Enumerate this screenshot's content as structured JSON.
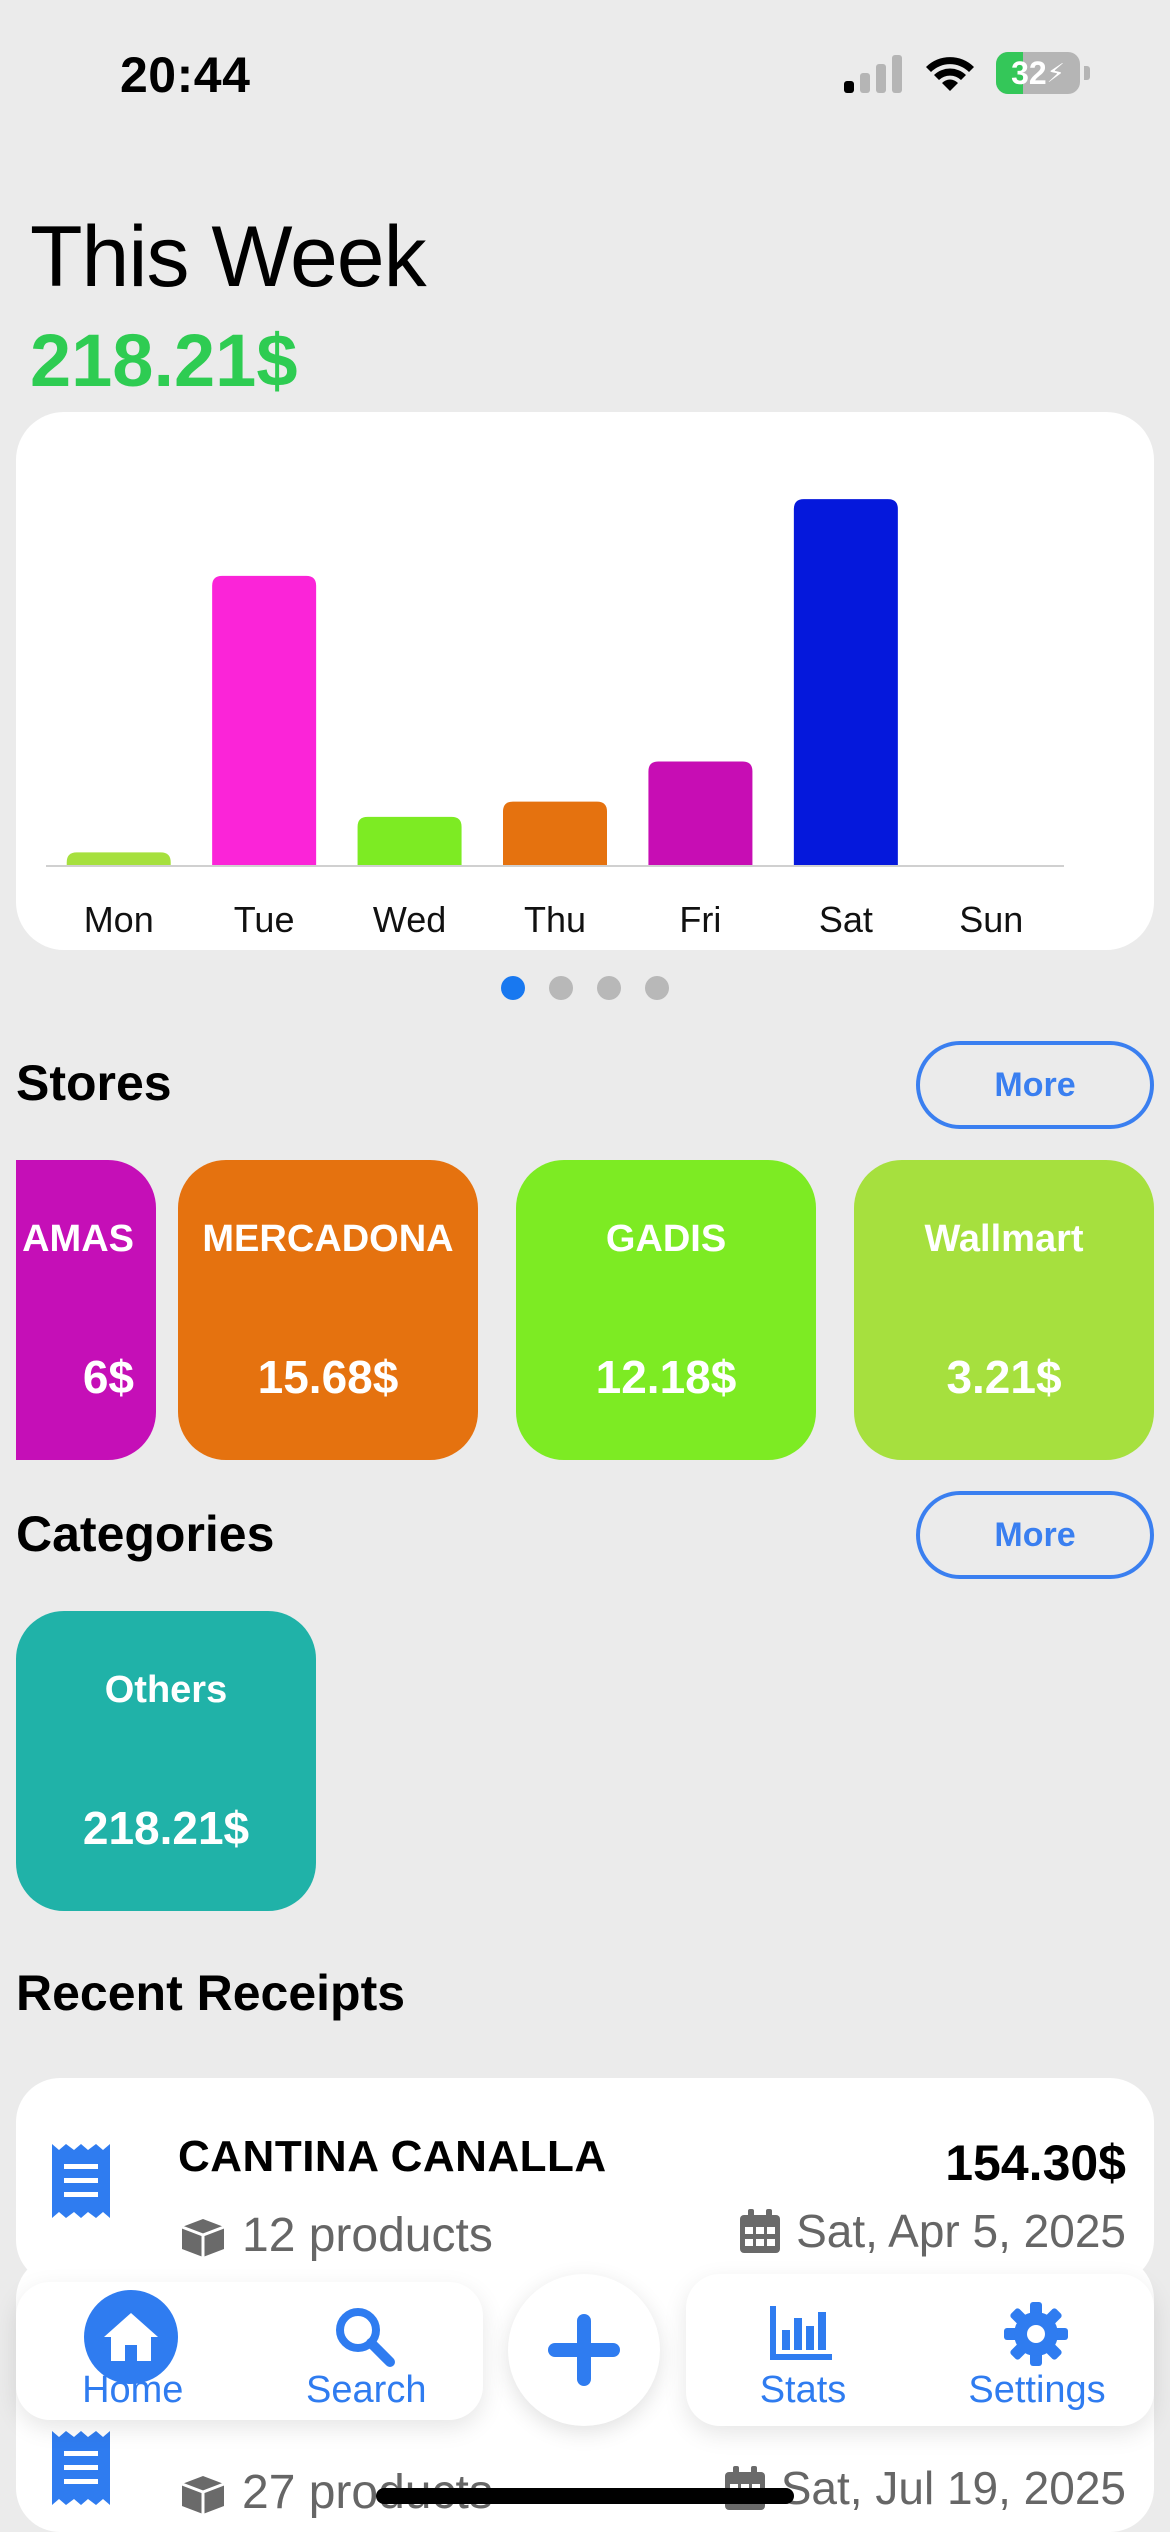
{
  "status_bar": {
    "time": "20:44",
    "battery_level": "32",
    "battery_percent": 32,
    "signal_bars_active": 1,
    "icons": [
      "cellular-signal-icon",
      "wifi-icon",
      "battery-charging-icon"
    ]
  },
  "header": {
    "title": "This Week",
    "total": "218.21$",
    "total_color": "#2ecc52"
  },
  "chart_data": {
    "type": "bar",
    "categories": [
      "Mon",
      "Tue",
      "Wed",
      "Thu",
      "Fri",
      "Sat",
      "Sun"
    ],
    "values": [
      3.2,
      68,
      11.5,
      15.1,
      24.5,
      86,
      0
    ],
    "colors": [
      "#a6e03e",
      "#fb24d8",
      "#7deb23",
      "#e5720f",
      "#c70db4",
      "#0518dc",
      "#cccccc"
    ],
    "title": "",
    "xlabel": "",
    "ylabel": "",
    "ylim": [
      0,
      90
    ],
    "grid": false,
    "legend": "none",
    "page_indicator": {
      "pages": 4,
      "active": 1
    }
  },
  "stores": {
    "title": "Stores",
    "more_label": "More",
    "items": [
      {
        "name": "AMAS",
        "amount": "6$",
        "color": "#c50fb7"
      },
      {
        "name": "MERCADONA",
        "amount": "15.68$",
        "color": "#e5720f"
      },
      {
        "name": "GADIS",
        "amount": "12.18$",
        "color": "#7deb23"
      },
      {
        "name": "Wallmart",
        "amount": "3.21$",
        "color": "#a6e03e"
      }
    ]
  },
  "categories": {
    "title": "Categories",
    "more_label": "More",
    "items": [
      {
        "name": "Others",
        "amount": "218.21$",
        "color": "#20b2a8"
      }
    ]
  },
  "recent_receipts": {
    "title": "Recent Receipts",
    "items": [
      {
        "store": "CANTINA CANALLA",
        "total": "154.30$",
        "products": "12 products",
        "date": "Sat, Apr 5, 2025"
      },
      {
        "store": "",
        "total": "",
        "products": "27 products",
        "date": "Sat, Jul 19, 2025"
      }
    ]
  },
  "tab_bar": {
    "home": "Home",
    "search": "Search",
    "stats": "Stats",
    "settings": "Settings",
    "accent": "#2f7cf0"
  }
}
